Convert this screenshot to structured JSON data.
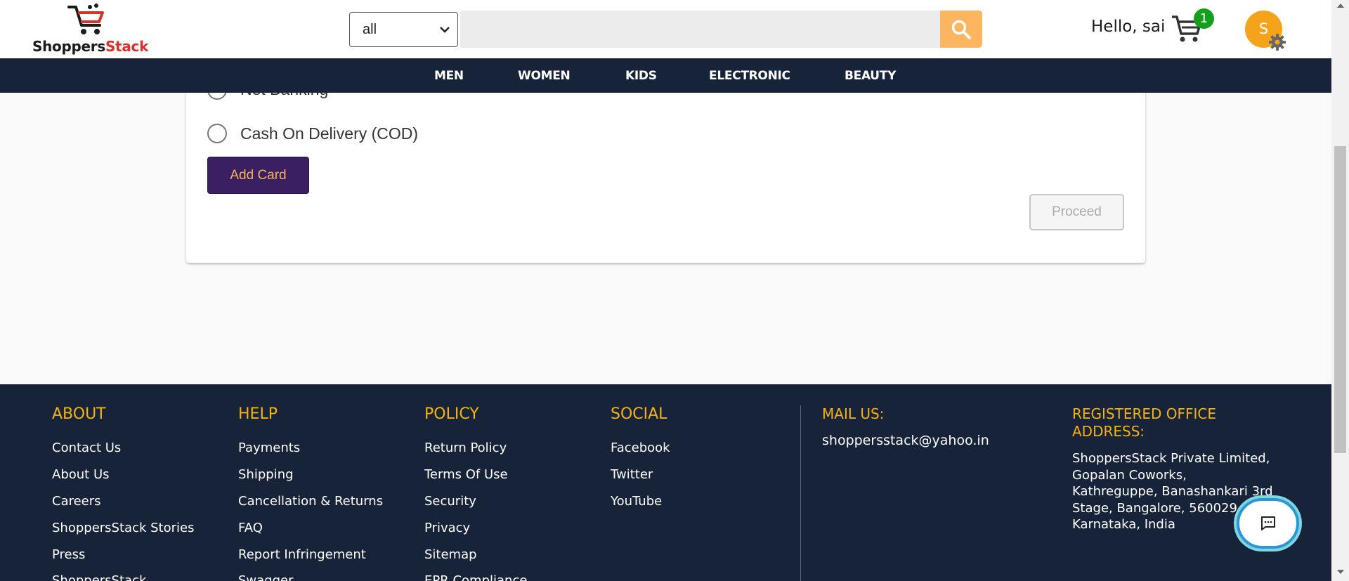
{
  "header": {
    "logo": {
      "part1": "Shoppers",
      "part2": "Stack"
    },
    "category_select": {
      "value": "all"
    },
    "search": {
      "placeholder": ""
    },
    "greeting": "Hello, sai",
    "cart_count": "1",
    "avatar_initial": "S"
  },
  "nav": {
    "items": [
      "MEN",
      "WOMEN",
      "KIDS",
      "ELECTRONIC",
      "BEAUTY"
    ]
  },
  "payment": {
    "options": [
      "Net Banking",
      "Cash On Delivery (COD)"
    ],
    "add_card_label": "Add Card",
    "proceed_label": "Proceed"
  },
  "footer": {
    "about": {
      "heading": "ABOUT",
      "links": [
        "Contact Us",
        "About Us",
        "Careers",
        "ShoppersStack Stories",
        "Press",
        "ShoppersStack"
      ]
    },
    "help": {
      "heading": "HELP",
      "links": [
        "Payments",
        "Shipping",
        "Cancellation & Returns",
        "FAQ",
        "Report Infringement",
        "Swagger"
      ]
    },
    "policy": {
      "heading": "POLICY",
      "links": [
        "Return Policy",
        "Terms Of Use",
        "Security",
        "Privacy",
        "Sitemap",
        "EPR Compliance"
      ]
    },
    "social": {
      "heading": "SOCIAL",
      "links": [
        "Facebook",
        "Twitter",
        "YouTube"
      ]
    },
    "mail": {
      "heading": "MAIL US:",
      "address": "shoppersstack@yahoo.in"
    },
    "office": {
      "heading": "REGISTERED OFFICE ADDRESS:",
      "lines": [
        "ShoppersStack Private Limited,",
        "Gopalan Coworks,",
        "Kathreguppe, Banashankari 3rd",
        "Stage, Bangalore, 560029,",
        "Karnataka, India"
      ]
    }
  },
  "colors": {
    "navy": "#172338",
    "accent_orange": "#fdb55f",
    "footer_heading": "#f6b213",
    "add_card_bg": "#3a1f62",
    "cart_badge": "#14a01e"
  }
}
